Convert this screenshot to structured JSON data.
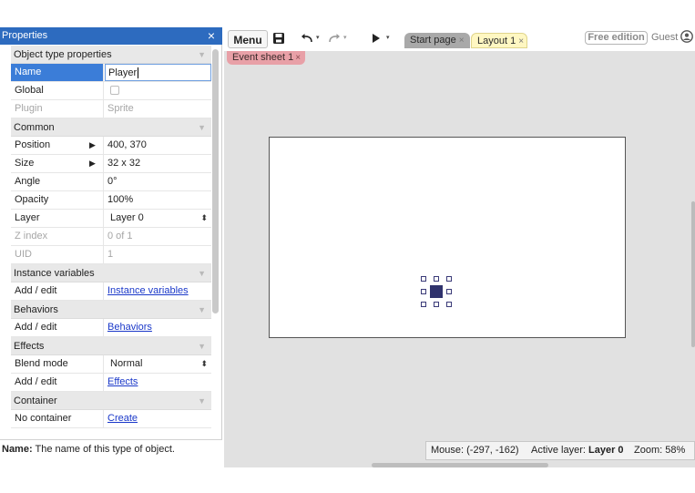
{
  "properties_panel": {
    "title": "Properties",
    "close_glyph": "×",
    "rows": [
      {
        "kind": "section",
        "label": "Object type properties"
      },
      {
        "kind": "row",
        "key": "Name",
        "value": "Player",
        "state": "selected"
      },
      {
        "kind": "row",
        "key": "Global",
        "value": "",
        "control": "checkbox",
        "checked": false
      },
      {
        "kind": "row",
        "key": "Plugin",
        "value": "Sprite",
        "state": "disabled"
      },
      {
        "kind": "section",
        "label": "Common"
      },
      {
        "kind": "row",
        "key": "Position",
        "value": "400, 370",
        "expander": true
      },
      {
        "kind": "row",
        "key": "Size",
        "value": "32 x 32",
        "expander": true
      },
      {
        "kind": "row",
        "key": "Angle",
        "value": "0°"
      },
      {
        "kind": "row",
        "key": "Opacity",
        "value": "100%"
      },
      {
        "kind": "row",
        "key": "Layer",
        "value": "Layer 0",
        "control": "dropdown"
      },
      {
        "kind": "row",
        "key": "Z index",
        "value": "0 of 1",
        "state": "disabled"
      },
      {
        "kind": "row",
        "key": "UID",
        "value": "1",
        "state": "disabled"
      },
      {
        "kind": "section",
        "label": "Instance variables"
      },
      {
        "kind": "row",
        "key": "Add / edit",
        "value": "Instance variables",
        "control": "link"
      },
      {
        "kind": "section",
        "label": "Behaviors"
      },
      {
        "kind": "row",
        "key": "Add / edit",
        "value": "Behaviors",
        "control": "link"
      },
      {
        "kind": "section",
        "label": "Effects"
      },
      {
        "kind": "row",
        "key": "Blend mode",
        "value": "Normal",
        "control": "dropdown"
      },
      {
        "kind": "row",
        "key": "Add / edit",
        "value": "Effects",
        "control": "link"
      },
      {
        "kind": "section",
        "label": "Container"
      },
      {
        "kind": "row",
        "key": "No container",
        "value": "Create",
        "control": "link"
      }
    ],
    "help": {
      "label": "Name:",
      "text": "The name of this type of object."
    }
  },
  "toolbar": {
    "menu_label": "Menu",
    "icons": [
      "save-icon",
      "undo-icon",
      "redo-icon",
      "play-icon"
    ],
    "tabs": [
      {
        "label": "Start page",
        "active": false
      },
      {
        "label": "Layout 1",
        "active": true
      }
    ],
    "tab_close_glyph": "×",
    "edition_badge": "Free edition",
    "user": "Guest"
  },
  "event_sheet_tab": {
    "label": "Event sheet 1"
  },
  "status_bar": {
    "mouse": "Mouse: (-297, -162)",
    "active_layer_label": "Active layer:",
    "active_layer_value": "Layer 0",
    "zoom": "Zoom: 58%"
  },
  "colors": {
    "panel_title": "#2d6bbf",
    "selected_key": "#3b7dd8",
    "layout_tab": "#fff7c2",
    "event_tab": "#e8a0a7",
    "sprite": "#30336d",
    "link": "#1a38c9"
  }
}
